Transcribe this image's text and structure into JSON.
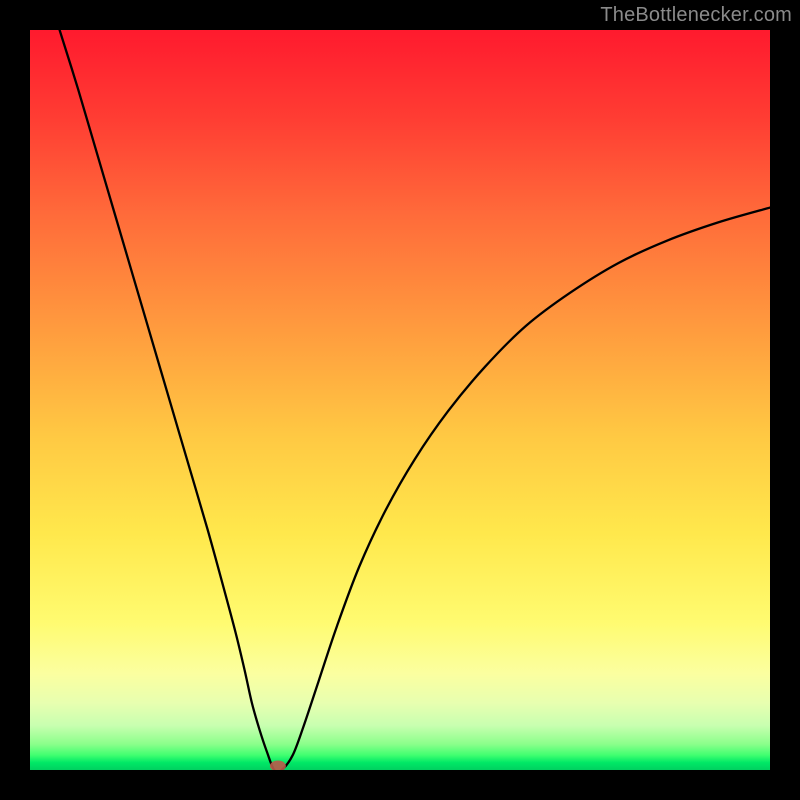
{
  "watermark": "TheBottlenecker.com",
  "chart_data": {
    "type": "line",
    "title": "",
    "xlabel": "",
    "ylabel": "",
    "xlim": [
      0,
      100
    ],
    "ylim": [
      0,
      100
    ],
    "x": [
      4.0,
      6.5,
      9.0,
      11.5,
      14.0,
      16.5,
      19.0,
      21.5,
      24.0,
      26.2,
      27.8,
      29.0,
      30.0,
      31.0,
      32.0,
      33.0,
      34.0,
      35.5,
      37.0,
      39.0,
      41.5,
      44.5,
      48.0,
      52.0,
      56.5,
      61.5,
      67.0,
      73.0,
      79.5,
      86.0,
      93.0,
      100.0
    ],
    "y": [
      100.0,
      92.0,
      83.5,
      75.0,
      66.5,
      58.0,
      49.5,
      41.0,
      32.5,
      24.5,
      18.5,
      13.5,
      9.0,
      5.5,
      2.5,
      0.0,
      0.0,
      2.0,
      6.0,
      12.0,
      19.5,
      27.5,
      35.0,
      42.0,
      48.5,
      54.5,
      60.0,
      64.5,
      68.5,
      71.5,
      74.0,
      76.0
    ],
    "marker": {
      "x": 33.5,
      "y": 0.0
    },
    "gradient_colors": {
      "top": "#ff1a2e",
      "mid_upper": "#ff9a3e",
      "mid": "#ffe84c",
      "mid_lower": "#fbffa0",
      "bottom": "#00d060"
    },
    "line_color": "#000000",
    "marker_color": "#b95a4a",
    "background": "#000000"
  }
}
